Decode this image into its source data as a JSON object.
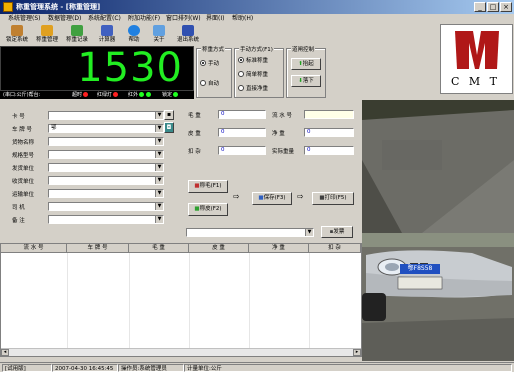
{
  "window": {
    "title": "称重管理系统 - [称重管理]",
    "controls": [
      "_",
      "□",
      "×"
    ]
  },
  "menu": {
    "items": [
      "系统管理(S)",
      "数据管理(D)",
      "系统配置(C)",
      "附加功能(F)",
      "窗口排列(W)",
      "界面(I)",
      "帮助(H)"
    ]
  },
  "toolbar": {
    "items": [
      {
        "label": "锁定系统",
        "icon": "lock-icon"
      },
      {
        "label": "称重管理",
        "icon": "scale-icon"
      },
      {
        "label": "称重记录",
        "icon": "records-icon"
      },
      {
        "label": "计算器",
        "icon": "calculator-icon"
      },
      {
        "label": "帮助",
        "icon": "help-icon"
      },
      {
        "label": "关于",
        "icon": "about-icon"
      },
      {
        "label": "退出系统",
        "icon": "exit-icon"
      }
    ]
  },
  "display": {
    "weight": "1530",
    "status_text": "(串口:公斤)帮台:",
    "indicators": [
      {
        "label": "超时",
        "color": "#ff2020"
      },
      {
        "label": "红绿灯",
        "color": "#ff2020"
      },
      {
        "label": "红外",
        "color": "#20ff20"
      },
      {
        "label": "锁定",
        "color": "#20ff20"
      }
    ]
  },
  "weigh_mode": {
    "title": "称重方式",
    "options": [
      {
        "label": "手动",
        "selected": true
      },
      {
        "label": "自动",
        "selected": false
      }
    ]
  },
  "manual_mode": {
    "title": "手动方式(F1)",
    "options": [
      {
        "label": "标准称重",
        "selected": true
      },
      {
        "label": "简单称重",
        "selected": false
      },
      {
        "label": "直接净重",
        "selected": false
      }
    ]
  },
  "gate_control": {
    "title": "道闸控制",
    "raise_label": "抬起",
    "lower_label": "落下"
  },
  "logo": {
    "text": "C M T"
  },
  "form": {
    "fields": [
      {
        "label": "卡    号",
        "value": ""
      },
      {
        "label": "车 牌 号",
        "value": "鄂"
      },
      {
        "label": "货物名称",
        "value": ""
      },
      {
        "label": "规格型号",
        "value": ""
      },
      {
        "label": "发货单位",
        "value": ""
      },
      {
        "label": "收货单位",
        "value": ""
      },
      {
        "label": "运输单位",
        "value": ""
      },
      {
        "label": "司    机",
        "value": ""
      },
      {
        "label": "备    注",
        "value": ""
      }
    ]
  },
  "weights": {
    "gross_label": "毛    重",
    "gross_value": "0",
    "tare_label": "皮    重",
    "tare_value": "0",
    "deduct_label": "扣    杂",
    "deduct_value": "0",
    "serial_label": "流 水 号",
    "serial_value": "",
    "net_label": "净    重",
    "net_value": "0",
    "actual_label": "实际重量",
    "actual_value": "0"
  },
  "actions": {
    "gross_btn": "称毛(F1)",
    "tare_btn": "称皮(F2)",
    "save_btn": "保存(F3)",
    "print_btn": "打印(F5)",
    "reprint_btn": "发票"
  },
  "table": {
    "columns": [
      "流 水 号",
      "车 牌 号",
      "毛    重",
      "皮    重",
      "净    重",
      "扣    杂"
    ]
  },
  "camera": {
    "plate_text": "鄂F8S58"
  },
  "statusbar": {
    "cells": [
      "[试用版]",
      "2007-04-30  16:45:45",
      "操作员:系统管理员",
      "计量单位:公斤"
    ]
  }
}
